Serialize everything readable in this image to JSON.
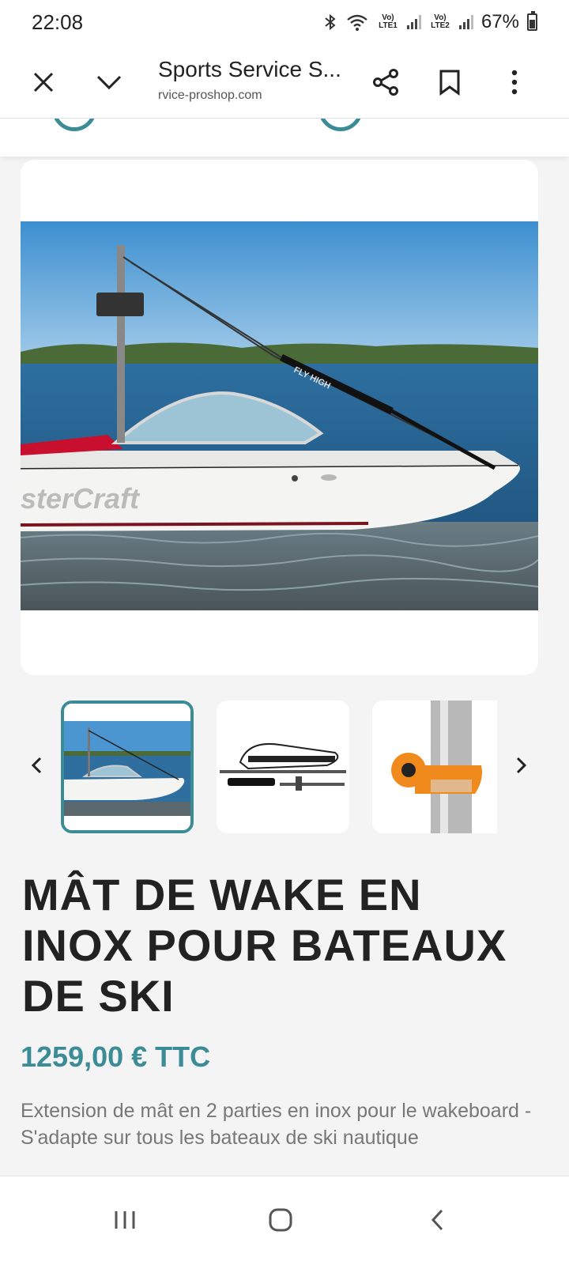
{
  "status_bar": {
    "time": "22:08",
    "battery": "67%",
    "sim1": "Vo) LTE1",
    "sim2": "Vo) LTE2",
    "icons": [
      "bluetooth-icon",
      "wifi-icon",
      "signal-icon",
      "battery-icon"
    ]
  },
  "browser": {
    "title": "Sports Service S...",
    "url": "rvice-proshop.com",
    "icons": [
      "close-icon",
      "chevron-down-icon",
      "share-icon",
      "bookmark-icon",
      "more-icon"
    ]
  },
  "gallery": {
    "thumbnails": [
      "boat-thumb",
      "mast-kit-thumb",
      "orange-clamp-thumb"
    ],
    "active_index": 0
  },
  "product": {
    "title": "MÂT DE WAKE EN INOX POUR BATEAUX DE SKI",
    "price": "1259,00 € TTC",
    "description": "Extension de mât en 2 parties en inox pour le wakeboard - S'adapte sur tous les bateaux de ski nautique",
    "hull_brand_text": "sterCraft",
    "pole_text": "FLY HIGH"
  },
  "colors": {
    "accent": "#3b8c96",
    "text": "#222222",
    "muted": "#777777",
    "background": "#f4f4f4"
  },
  "nav": {
    "icons": [
      "recent-apps-icon",
      "home-icon",
      "back-icon"
    ]
  }
}
